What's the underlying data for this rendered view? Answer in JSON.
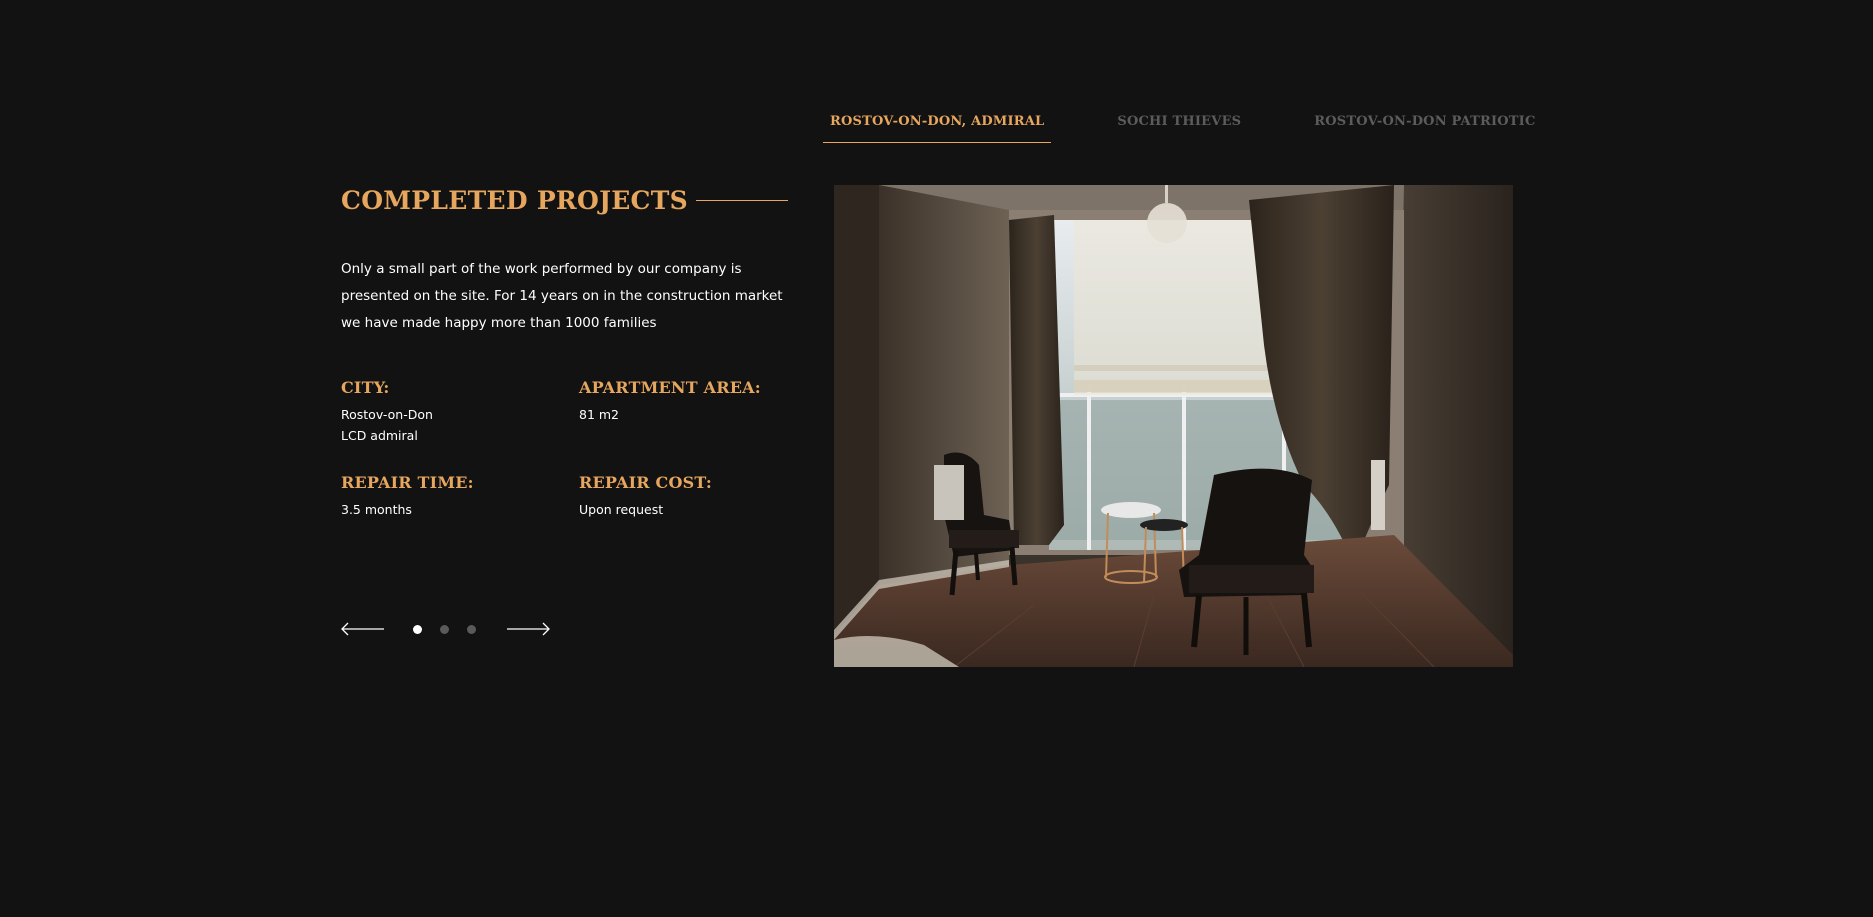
{
  "tabs": [
    {
      "label": "ROSTOV-ON-DON, ADMIRAL",
      "active": true
    },
    {
      "label": "SOCHI THIEVES",
      "active": false
    },
    {
      "label": "ROSTOV-ON-DON PATRIOTIC",
      "active": false
    }
  ],
  "section": {
    "title": "COMPLETED PROJECTS",
    "intro": "Only a small part of the work performed by our company is presented on the site. For 14 years on in the construction market we have made happy more than 1000 families"
  },
  "info": {
    "city_label": "CITY:",
    "city_line1": "Rostov-on-Don",
    "city_line2": "LCD admiral",
    "area_label": "APARTMENT AREA:",
    "area_value": "81 m2",
    "time_label": "REPAIR TIME:",
    "time_value": "3.5 months",
    "cost_label": "REPAIR COST:",
    "cost_value": "Upon request"
  },
  "slider": {
    "slide_count": 3,
    "active_index": 0,
    "prev_icon": "arrow-left-icon",
    "next_icon": "arrow-right-icon"
  },
  "colors": {
    "background": "#121212",
    "accent": "#e6a65e",
    "inactive_tab": "#5c5c5c",
    "text": "#ffffff"
  }
}
